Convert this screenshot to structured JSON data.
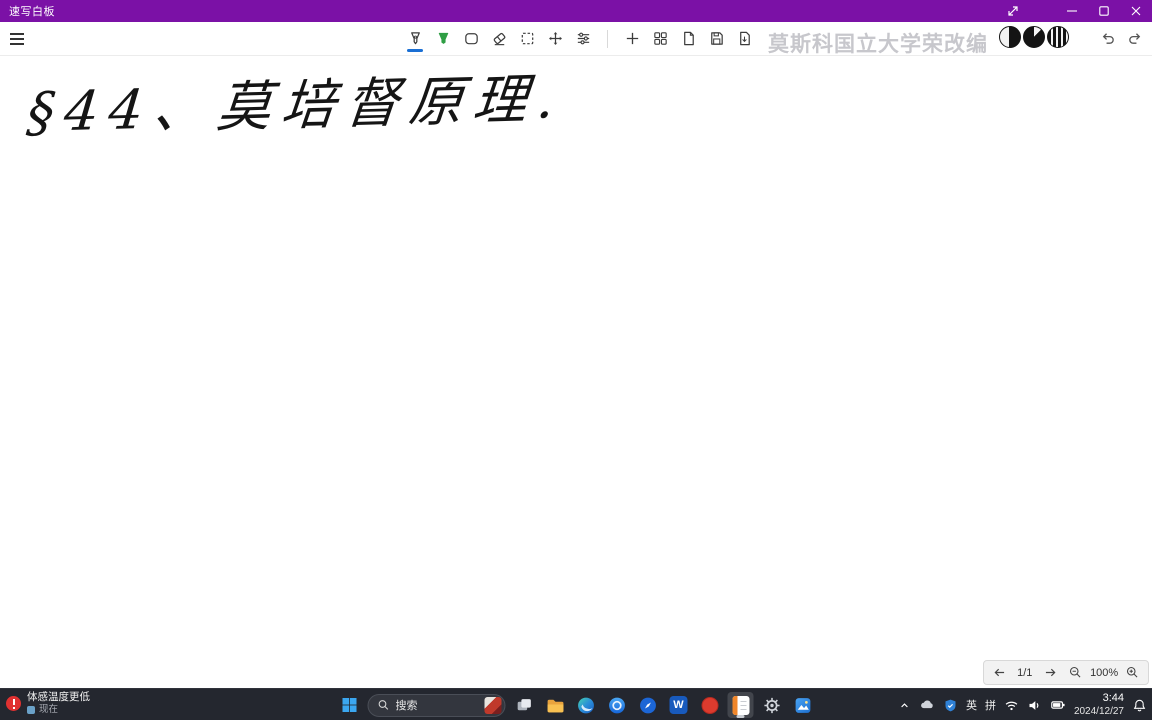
{
  "window": {
    "title": "速写白板"
  },
  "toolbar": {
    "watermark": "莫斯科国立大学荣改编"
  },
  "canvas": {
    "handwriting": "§44、莫培督原理."
  },
  "pager": {
    "page": "1/1",
    "zoom": "100%"
  },
  "taskbar": {
    "widget": {
      "line1": "体感温度更低",
      "line2": "现在"
    },
    "search": {
      "label": "搜索"
    },
    "apps": {
      "word_badge": "W"
    },
    "tray": {
      "ime_a": "英",
      "ime_b": "拼",
      "time": "3:44",
      "date": "2024/12/27"
    }
  },
  "colors": {
    "titlebar": "#7b11a6",
    "accent": "#1a6fd4",
    "taskbar": "#1d2028"
  }
}
